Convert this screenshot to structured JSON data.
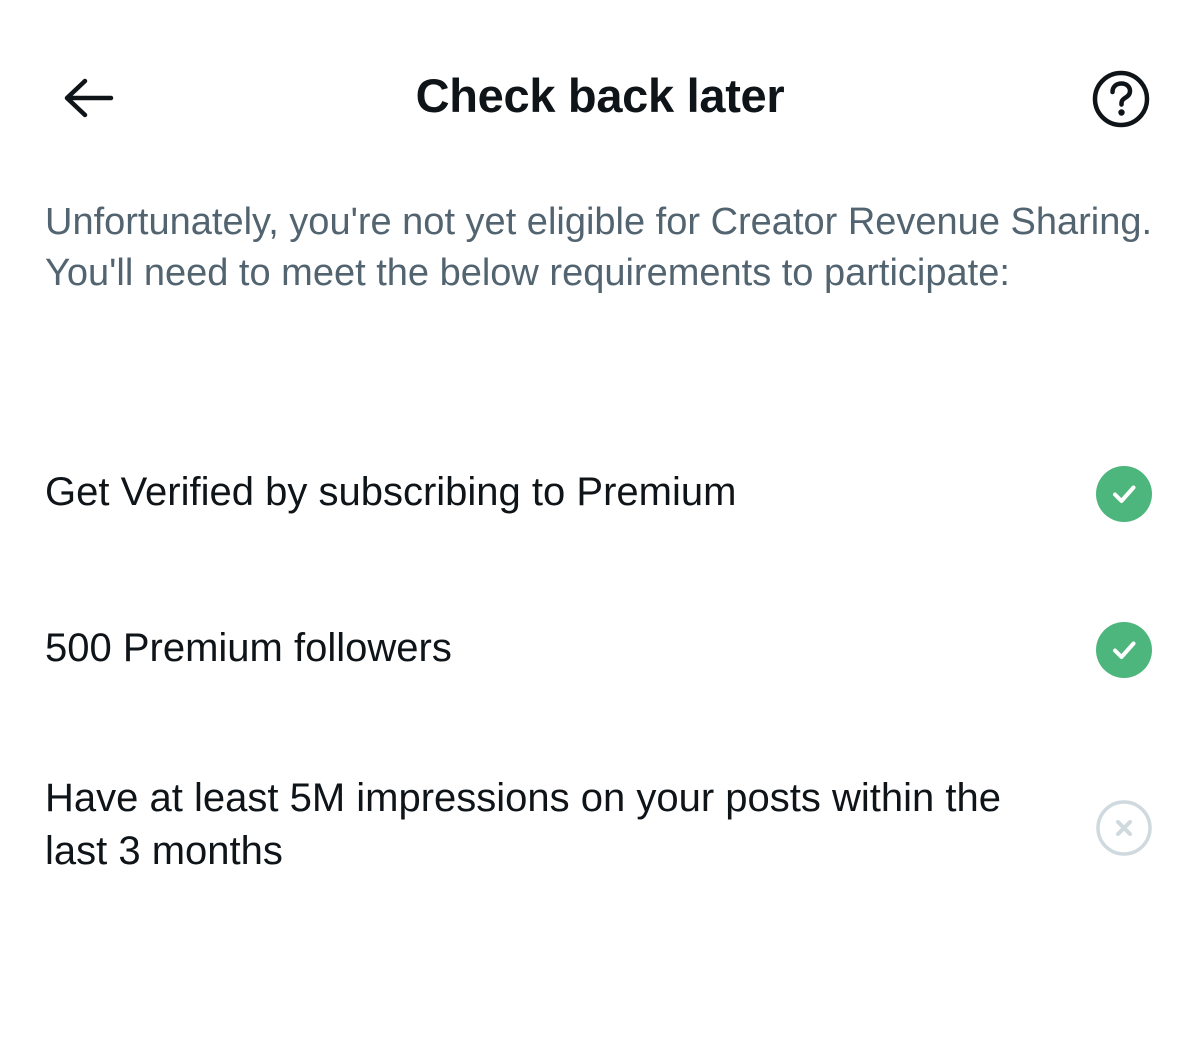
{
  "header": {
    "title": "Check back later",
    "back_icon": "arrow-left-icon",
    "help_icon": "question-circle-icon"
  },
  "intro": {
    "text": "Unfortunately, you're not yet eligible for Creator Revenue Sharing. You'll need to meet the below requirements to participate:"
  },
  "requirements": [
    {
      "label": "Get Verified by subscribing to Premium",
      "met": true,
      "icon": "check-circle-icon"
    },
    {
      "label": "500 Premium followers",
      "met": true,
      "icon": "check-circle-icon"
    },
    {
      "label": "Have at least 5M impressions on your posts within the last 3 months",
      "met": false,
      "icon": "x-circle-icon"
    }
  ],
  "colors": {
    "met": "#4cb67d",
    "unmet": "#cfd9de",
    "text_primary": "#0f1419",
    "text_secondary": "#536471"
  }
}
